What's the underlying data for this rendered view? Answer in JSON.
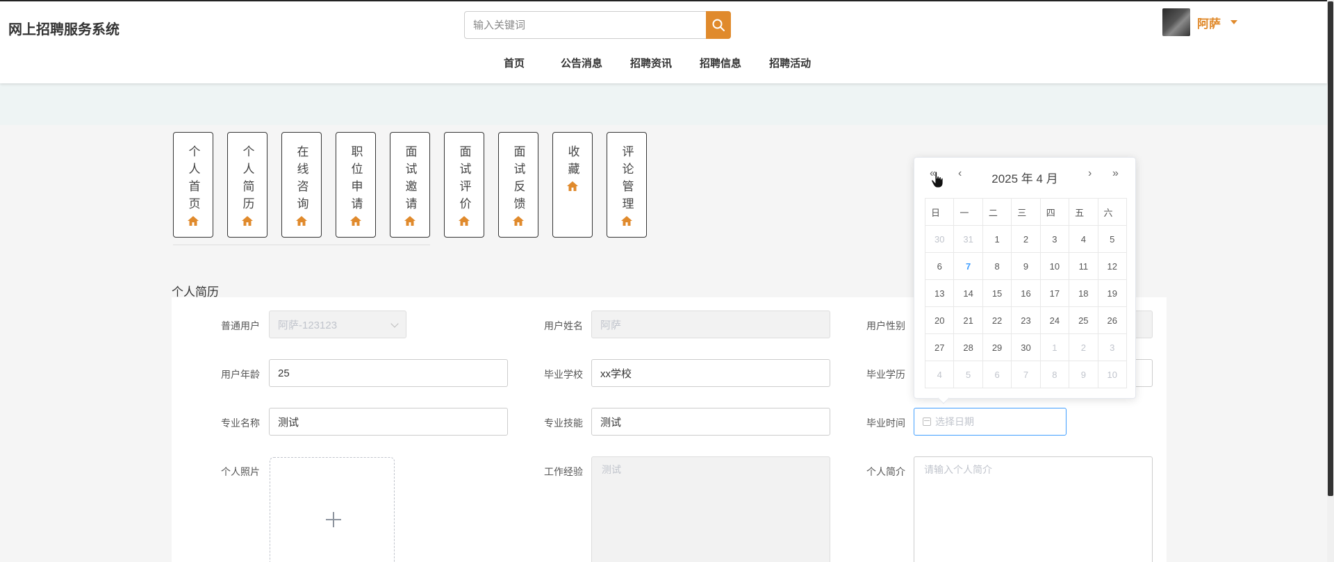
{
  "header": {
    "site_title": "网上招聘服务系统",
    "search_placeholder": "输入关键词",
    "user_name": "阿萨",
    "nav": [
      "首页",
      "公告消息",
      "招聘资讯",
      "招聘信息",
      "招聘活动"
    ]
  },
  "side_menu": [
    {
      "label": "个人首页"
    },
    {
      "label": "个人简历"
    },
    {
      "label": "在线咨询"
    },
    {
      "label": "职位申请"
    },
    {
      "label": "面试邀请"
    },
    {
      "label": "面试评价"
    },
    {
      "label": "面试反馈"
    },
    {
      "label": "收藏"
    },
    {
      "label": "评论管理"
    }
  ],
  "section_title": "个人简历",
  "form": {
    "user_type_label": "普通用户",
    "user_type_value": "阿萨-123123",
    "name_label": "用户姓名",
    "name_value": "阿萨",
    "gender_label": "用户性别",
    "age_label": "用户年龄",
    "age_value": "25",
    "school_label": "毕业学校",
    "school_value": "xx学校",
    "degree_label": "毕业学历",
    "major_label": "专业名称",
    "major_value": "测试",
    "skill_label": "专业技能",
    "skill_value": "测试",
    "grad_time_label": "毕业时间",
    "grad_time_placeholder": "选择日期",
    "photo_label": "个人照片",
    "experience_label": "工作经验",
    "experience_value": "测试",
    "intro_label": "个人简介",
    "intro_placeholder": "请输入个人简介"
  },
  "datepicker": {
    "title": "2025 年  4 月",
    "weekdays": [
      "日",
      "一",
      "二",
      "三",
      "四",
      "五",
      "六"
    ],
    "weeks": [
      [
        {
          "d": "30",
          "o": true
        },
        {
          "d": "31",
          "o": true
        },
        {
          "d": "1"
        },
        {
          "d": "2"
        },
        {
          "d": "3"
        },
        {
          "d": "4"
        },
        {
          "d": "5"
        }
      ],
      [
        {
          "d": "6"
        },
        {
          "d": "7",
          "t": true
        },
        {
          "d": "8"
        },
        {
          "d": "9"
        },
        {
          "d": "10"
        },
        {
          "d": "11"
        },
        {
          "d": "12"
        }
      ],
      [
        {
          "d": "13"
        },
        {
          "d": "14"
        },
        {
          "d": "15"
        },
        {
          "d": "16"
        },
        {
          "d": "17"
        },
        {
          "d": "18"
        },
        {
          "d": "19"
        }
      ],
      [
        {
          "d": "20"
        },
        {
          "d": "21"
        },
        {
          "d": "22"
        },
        {
          "d": "23"
        },
        {
          "d": "24"
        },
        {
          "d": "25"
        },
        {
          "d": "26"
        }
      ],
      [
        {
          "d": "27"
        },
        {
          "d": "28"
        },
        {
          "d": "29"
        },
        {
          "d": "30"
        },
        {
          "d": "1",
          "o": true
        },
        {
          "d": "2",
          "o": true
        },
        {
          "d": "3",
          "o": true
        }
      ],
      [
        {
          "d": "4",
          "o": true
        },
        {
          "d": "5",
          "o": true
        },
        {
          "d": "6",
          "o": true
        },
        {
          "d": "7",
          "o": true
        },
        {
          "d": "8",
          "o": true
        },
        {
          "d": "9",
          "o": true
        },
        {
          "d": "10",
          "o": true
        }
      ]
    ]
  },
  "colors": {
    "accent": "#e08a2c",
    "focus": "#409eff"
  }
}
